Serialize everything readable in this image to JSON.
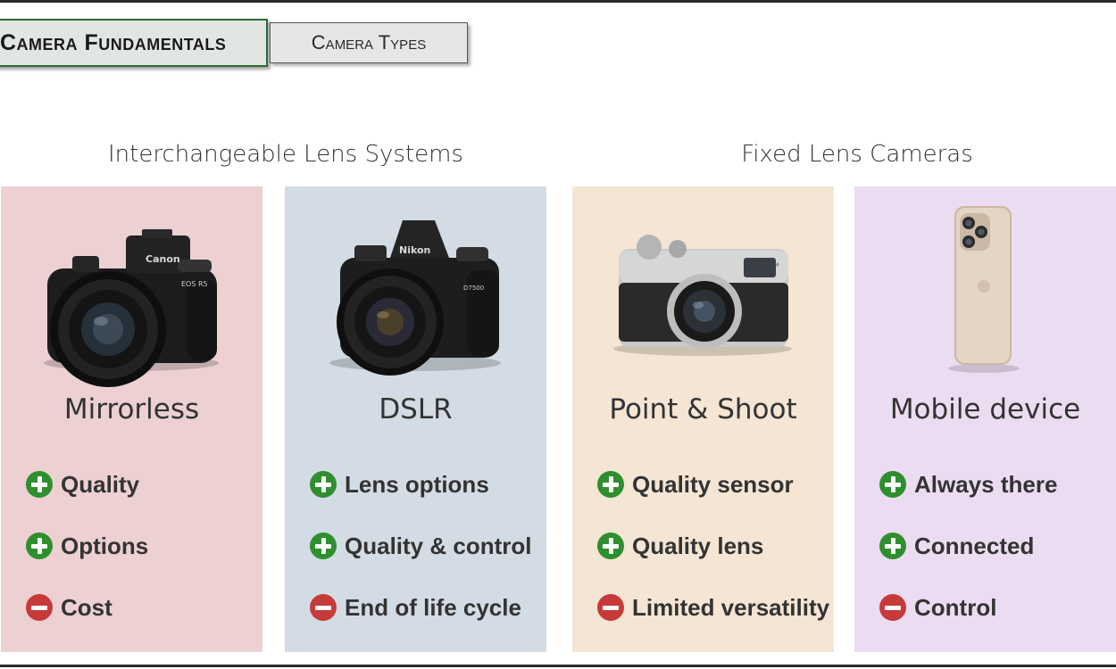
{
  "header": {
    "main_tab": "Camera Fundamentals",
    "sub_tab": "Camera Types"
  },
  "groups": {
    "left_heading": "Interchangeable Lens Systems",
    "right_heading": "Fixed Lens Cameras"
  },
  "cards": [
    {
      "title": "Mirrorless",
      "bg_color": "#ecd0d2",
      "image": "mirrorless-camera",
      "brand_text": "Canon",
      "model_text": "EOS R5",
      "features": [
        {
          "type": "plus",
          "icon": "plus-circle-icon",
          "label": "Quality"
        },
        {
          "type": "plus",
          "icon": "plus-circle-icon",
          "label": "Options"
        },
        {
          "type": "minus",
          "icon": "minus-circle-icon",
          "label": "Cost"
        }
      ]
    },
    {
      "title": "DSLR",
      "bg_color": "#d3dce5",
      "image": "dslr-camera",
      "brand_text": "Nikon",
      "model_text": "D7500",
      "features": [
        {
          "type": "plus",
          "icon": "plus-circle-icon",
          "label": "Lens options"
        },
        {
          "type": "plus",
          "icon": "plus-circle-icon",
          "label": "Quality & control"
        },
        {
          "type": "minus",
          "icon": "minus-circle-icon",
          "label": "End of life cycle"
        }
      ]
    },
    {
      "title": "Point & Shoot",
      "bg_color": "#f4e5d4",
      "image": "compact-camera",
      "brand_text": "FUJIFILM",
      "features": [
        {
          "type": "plus",
          "icon": "plus-circle-icon",
          "label": "Quality sensor"
        },
        {
          "type": "plus",
          "icon": "plus-circle-icon",
          "label": "Quality lens"
        },
        {
          "type": "minus",
          "icon": "minus-circle-icon",
          "label": "Limited versatility"
        }
      ]
    },
    {
      "title": "Mobile device",
      "bg_color": "#ecdcf1",
      "image": "smartphone",
      "features": [
        {
          "type": "plus",
          "icon": "plus-circle-icon",
          "label": "Always there"
        },
        {
          "type": "plus",
          "icon": "plus-circle-icon",
          "label": "Connected"
        },
        {
          "type": "minus",
          "icon": "minus-circle-icon",
          "label": "Control"
        }
      ]
    }
  ],
  "colors": {
    "plus": "#2f8f2f",
    "minus": "#c73a3a",
    "tab_border": "#2e6b33"
  }
}
